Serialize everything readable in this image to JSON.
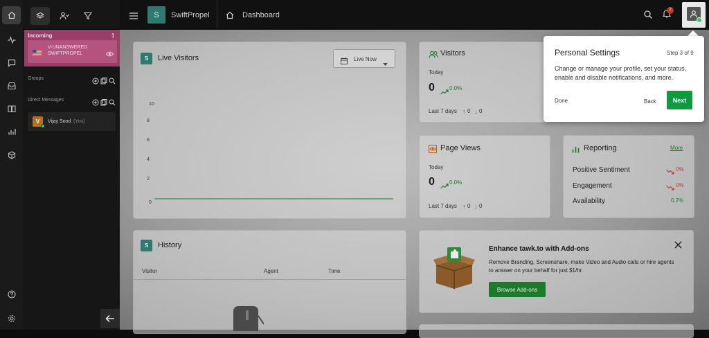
{
  "brand": {
    "initial": "S",
    "name": "SwiftPropel"
  },
  "header": {
    "page_title": "Dashboard",
    "notification_count": "7"
  },
  "sidebar": {
    "incoming_title": "Incoming",
    "incoming_count": "1",
    "incoming_item": {
      "line1": "V-UNANSWERED",
      "line2": "SWIFTPROPEL"
    },
    "groups_label": "Groups",
    "dm_label": "Direct Messages",
    "agent": {
      "initial": "V",
      "name": "Vijay Sood",
      "suffix": "(You)"
    }
  },
  "live_visitors": {
    "badge": "S",
    "title": "Live Visitors",
    "dropdown": "Live Now",
    "y_ticks": [
      "10",
      "8",
      "6",
      "4",
      "2",
      "0"
    ]
  },
  "visitors": {
    "title": "Visitors",
    "today_label": "Today",
    "today_value": "0",
    "change": "0.0%",
    "last7_label": "Last 7 days",
    "up": "0",
    "down": "0"
  },
  "page_views": {
    "title": "Page Views",
    "today_label": "Today",
    "today_value": "0",
    "change": "0.0%",
    "last7_label": "Last 7 days",
    "up": "0",
    "down": "0"
  },
  "reporting": {
    "title": "Reporting",
    "more": "More",
    "rows": [
      {
        "label": "Positive Sentiment",
        "value": "0%"
      },
      {
        "label": "Engagement",
        "value": "0%"
      },
      {
        "label": "Availability",
        "value": "0.2%"
      }
    ]
  },
  "history": {
    "badge": "S",
    "title": "History",
    "columns": [
      "Visitor",
      "Agent",
      "Time"
    ]
  },
  "addons": {
    "title": "Enhance tawk.to with Add-ons",
    "desc_line1": "Remove Branding, Screenshare, make Video and Audio calls or hire agents",
    "desc_line2": "to answer on your behalf for just $1/hr.",
    "button": "Browse Add-ons"
  },
  "popover": {
    "title": "Personal Settings",
    "step": "Step 3 of 9",
    "line1": "Change or manage your profile, set your status,",
    "line2": "enable and disable notifications, and more.",
    "done": "Done",
    "back": "Back",
    "next": "Next"
  },
  "colors": {
    "accent": "#2f7a6f",
    "incoming": "#9a3d69",
    "success": "#0e9a3e",
    "danger": "#c0392b"
  }
}
